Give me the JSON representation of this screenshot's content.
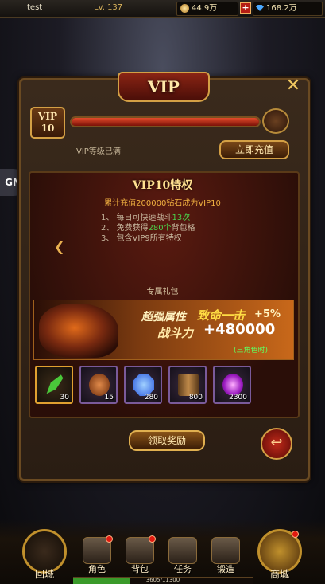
{
  "topbar": {
    "player_name": "test",
    "level": "Lv. 137",
    "gold": "44.9万",
    "diamonds": "168.2万",
    "gold_icon": "gold-coin-icon",
    "diamond_icon": "diamond-icon",
    "add_label": "+"
  },
  "side": {
    "gm_label": "GM"
  },
  "panel": {
    "title": "VIP",
    "close_label": "✕",
    "vip_badge_line1": "VIP",
    "vip_badge_line2": "10",
    "vip_progress": 1.0,
    "status_text": "VIP等级已满",
    "recharge_button": "立即充值"
  },
  "privilege": {
    "title": "VIP10特权",
    "requirement": "累计充值200000钻石成为VIP10",
    "perks": [
      {
        "prefix": "1、 每日可快速战斗",
        "highlight": "13次",
        "suffix": ""
      },
      {
        "prefix": "2、 免费获得",
        "highlight": "280个",
        "suffix": "背包格"
      },
      {
        "prefix": "3、 包含VIP9所有特权",
        "highlight": "",
        "suffix": ""
      }
    ],
    "prev_arrow": "❮"
  },
  "gift": {
    "label": "专属礼包",
    "banner": {
      "part1": "超强属性",
      "part2": "致命一击",
      "part3": "+5%",
      "part4": "战斗力",
      "part5": "+480000",
      "part6": "(三角色时)"
    },
    "items": [
      {
        "icon": "green-leaf-icon",
        "count": "30",
        "color": "#4ac83a"
      },
      {
        "icon": "bronze-orb-icon",
        "count": "15",
        "color": "#b05a2a"
      },
      {
        "icon": "blue-gem-icon",
        "count": "280",
        "color": "#2a7aff"
      },
      {
        "icon": "bronze-cylinder-icon",
        "count": "800",
        "color": "#b07a3a"
      },
      {
        "icon": "purple-orb-icon",
        "count": "2300",
        "color": "#c04ae0"
      }
    ],
    "claim_button": "领取奖励",
    "back_icon": "↩"
  },
  "bottom_nav": {
    "home": "回城",
    "character": "角色",
    "bag": "背包",
    "task": "任务",
    "forge": "锻造",
    "shop": "商城",
    "exp_text": "3605/11300",
    "exp_progress": 0.319
  }
}
